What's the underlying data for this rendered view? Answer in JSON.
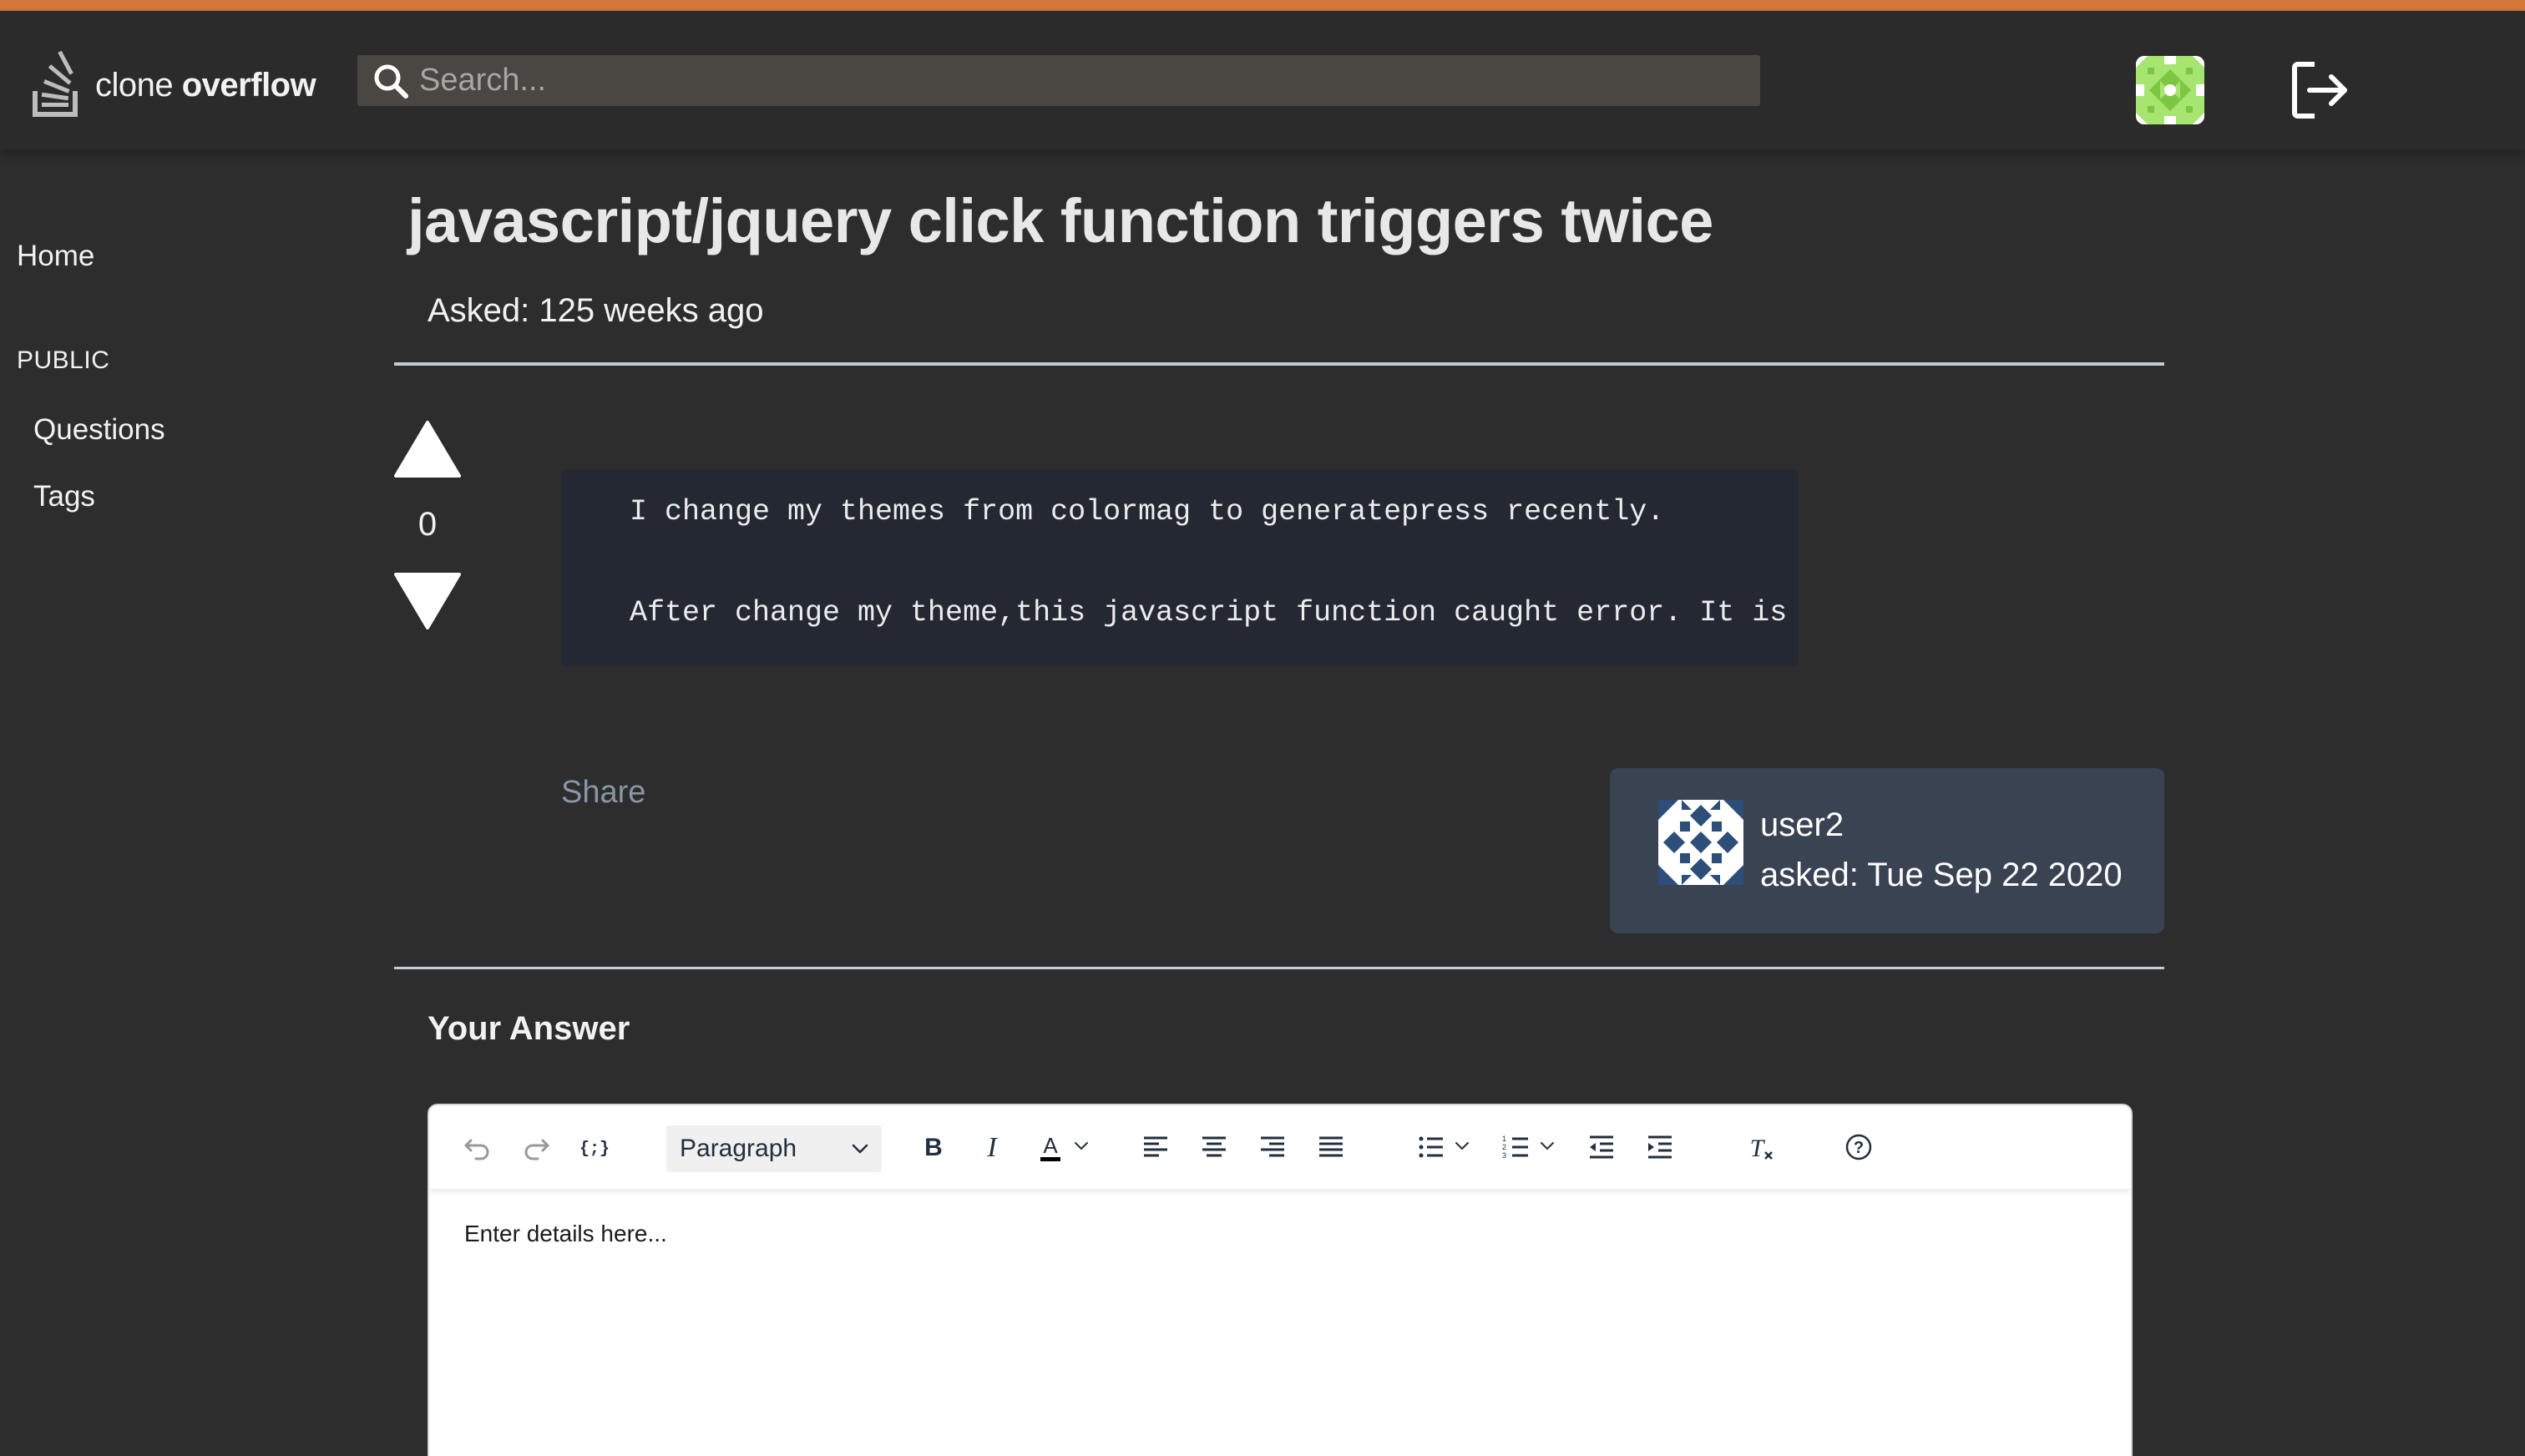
{
  "app": {
    "logo_light": "clone ",
    "logo_bold": "overflow",
    "accent_color": "#d3773a"
  },
  "search": {
    "placeholder": "Search..."
  },
  "sidebar": {
    "home": "Home",
    "section": "PUBLIC",
    "items": [
      {
        "label": "Questions"
      },
      {
        "label": "Tags"
      }
    ]
  },
  "question": {
    "title": "javascript/jquery click function triggers twice",
    "asked": "Asked: 125 weeks ago",
    "votes": "0",
    "body_lines": [
      "I change my themes from colormag to generatepress recently.",
      "After change my theme,this javascript function caught error. It is"
    ],
    "share_label": "Share",
    "author": {
      "name": "user2",
      "asked": "asked: Tue Sep 22 2020"
    }
  },
  "answer": {
    "heading": "Your Answer",
    "format_select": "Paragraph",
    "placeholder": "Enter details here..."
  },
  "icons": [
    "stack-logo-icon",
    "search-icon",
    "user-avatar",
    "logout-icon",
    "upvote-icon",
    "downvote-icon",
    "undo-icon",
    "redo-icon",
    "code-sample-icon",
    "bold-icon",
    "italic-icon",
    "text-color-icon",
    "align-left-icon",
    "align-center-icon",
    "align-right-icon",
    "justify-icon",
    "bullet-list-icon",
    "numbered-list-icon",
    "outdent-icon",
    "indent-icon",
    "clear-format-icon",
    "help-icon"
  ]
}
